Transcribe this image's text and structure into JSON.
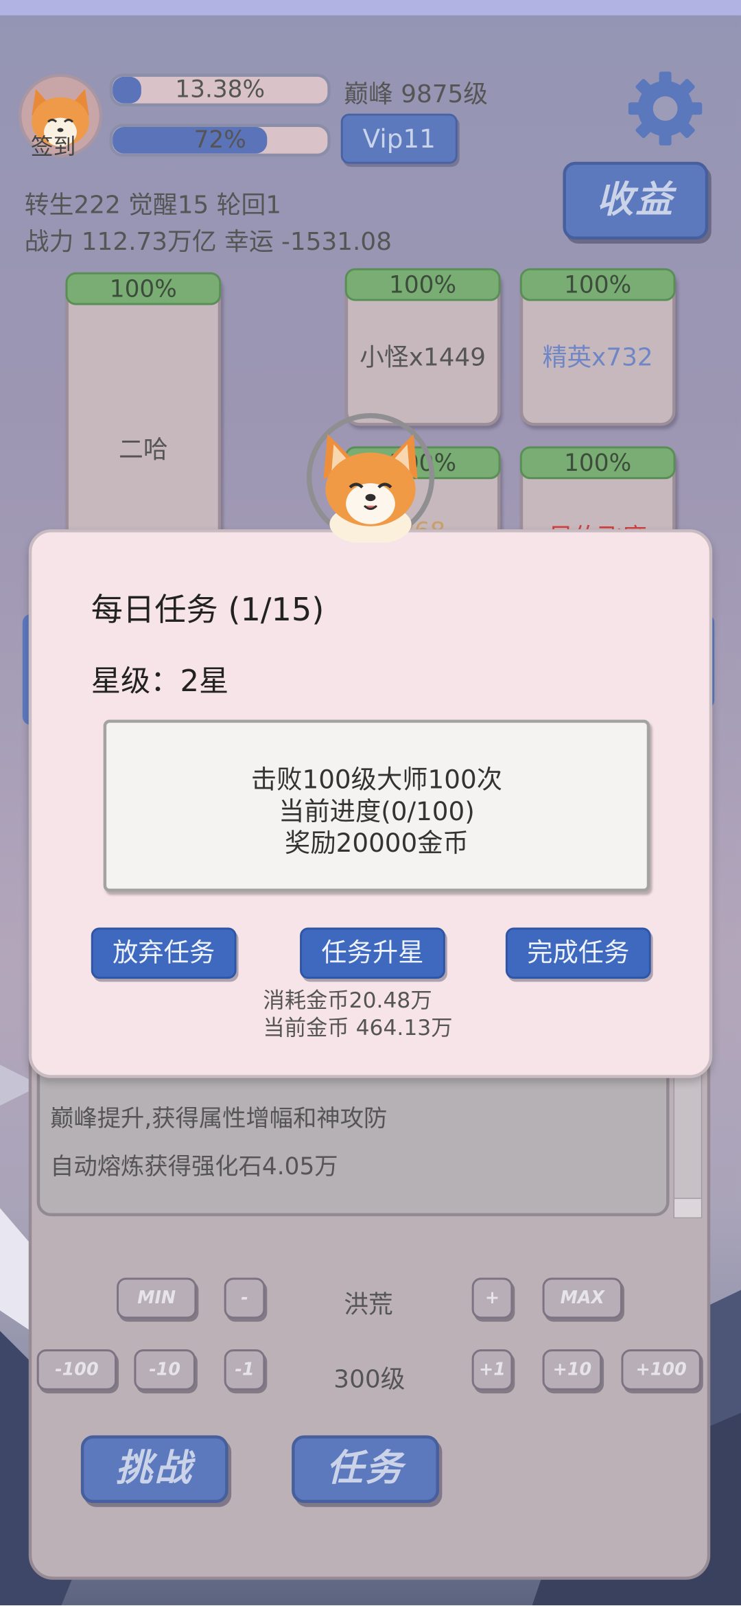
{
  "header": {
    "checkin_label": "签到",
    "exp_bar": {
      "percent": 13.38,
      "label": "13.38%"
    },
    "vip_bar": {
      "percent": 72,
      "label": "72%"
    },
    "peak_level": "巅峰 9875级",
    "vip_button": "Vip11",
    "income_button": "收益",
    "stats_line1": "转生222 觉醒15 轮回1",
    "stats_line2": "战力 112.73万亿  幸运 -1531.08"
  },
  "cards": [
    {
      "percent": "100%",
      "name": "二哈",
      "color": "#555555"
    },
    {
      "percent": "100%",
      "name": "小怪x1449",
      "color": "#555555"
    },
    {
      "percent": "100%",
      "name": "精英x732",
      "color": "#6f86c6"
    },
    {
      "percent": "100%",
      "name": "x68",
      "color": "#c9a06a"
    },
    {
      "percent": "100%",
      "name": "风伯飞廉",
      "color": "#d04040"
    }
  ],
  "log": {
    "lines": [
      "巅峰提升,获得属性增幅和神攻防",
      "自动熔炼获得强化石4.05万"
    ]
  },
  "controls": {
    "min_label": "MIN",
    "minus_label": "-",
    "zone": "洪荒",
    "plus_label": "+",
    "max_label": "MAX",
    "step_minus100": "-100",
    "step_minus10": "-10",
    "step_minus1": "-1",
    "level": "300级",
    "step_plus1": "+1",
    "step_plus10": "+10",
    "step_plus100": "+100",
    "challenge_button": "挑战",
    "task_button": "任务"
  },
  "dialog": {
    "title": "每日任务 (1/15)",
    "star": "星级：2星",
    "task_line1": "击败100级大师100次",
    "task_line2": "当前进度(0/100)",
    "task_line3": "奖励20000金币",
    "abandon_button": "放弃任务",
    "upgrade_button": "任务升星",
    "complete_button": "完成任务",
    "cost": "消耗金币20.48万",
    "current_gold": "当前金币 464.13万"
  },
  "colors": {
    "accent_blue": "#5d79be",
    "dialog_bg": "#f7e4e8",
    "card_bar_green": "#79ad74"
  }
}
